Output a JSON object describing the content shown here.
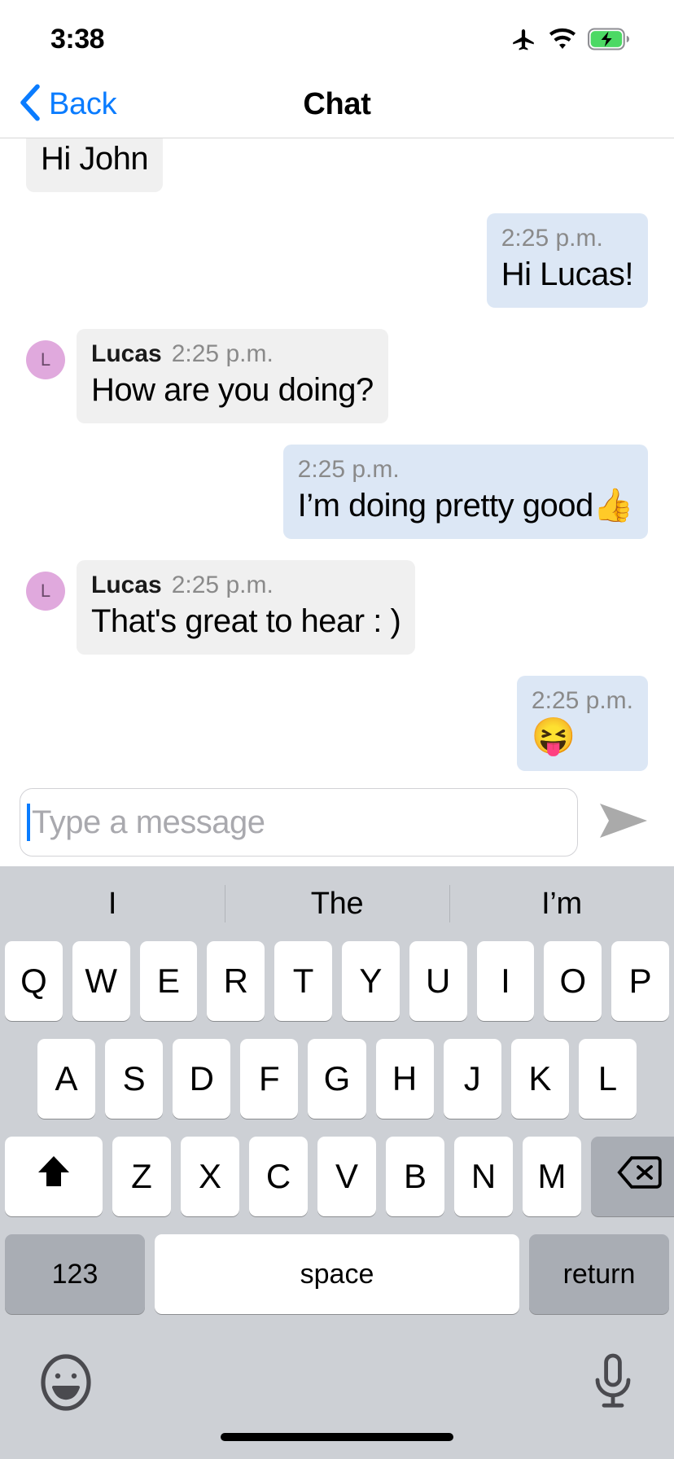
{
  "status_bar": {
    "time": "3:38",
    "icons": [
      "airplane-mode-icon",
      "wifi-icon",
      "battery-charging-icon"
    ]
  },
  "nav_bar": {
    "back_label": "Back",
    "title": "Chat"
  },
  "messages": [
    {
      "id": "msg-1",
      "direction": "in",
      "sender": "",
      "time": "",
      "text": "Hi John",
      "clipped": true,
      "show_avatar": false,
      "show_meta": false
    },
    {
      "id": "msg-2",
      "direction": "out",
      "sender": "",
      "time": "2:25 p.m.",
      "text": "Hi Lucas!",
      "clipped": false,
      "show_avatar": false,
      "show_meta": true
    },
    {
      "id": "msg-3",
      "direction": "in",
      "sender": "Lucas",
      "time": "2:25 p.m.",
      "text": "How are you doing?",
      "clipped": false,
      "show_avatar": true,
      "avatar_initial": "L",
      "show_meta": true
    },
    {
      "id": "msg-4",
      "direction": "out",
      "sender": "",
      "time": "2:25 p.m.",
      "text": "I’m doing pretty good👍",
      "clipped": false,
      "show_avatar": false,
      "show_meta": true
    },
    {
      "id": "msg-5",
      "direction": "in",
      "sender": "Lucas",
      "time": "2:25 p.m.",
      "text": "That's great to hear : )",
      "clipped": false,
      "show_avatar": true,
      "avatar_initial": "L",
      "show_meta": true
    },
    {
      "id": "msg-6",
      "direction": "out",
      "sender": "",
      "time": "2:25 p.m.",
      "text": "😝",
      "clipped": false,
      "show_avatar": false,
      "show_meta": true,
      "emoji_only": true
    }
  ],
  "composer": {
    "placeholder": "Type a message",
    "value": "",
    "send_icon": "send-arrow-icon"
  },
  "keyboard": {
    "predictions": [
      "I",
      "The",
      "I’m"
    ],
    "row1": [
      "Q",
      "W",
      "E",
      "R",
      "T",
      "Y",
      "U",
      "I",
      "O",
      "P"
    ],
    "row2": [
      "A",
      "S",
      "D",
      "F",
      "G",
      "H",
      "J",
      "K",
      "L"
    ],
    "row3": [
      "Z",
      "X",
      "C",
      "V",
      "B",
      "N",
      "M"
    ],
    "shift_label": "shift-up-arrow-icon",
    "backspace_label": "backspace-delete-icon",
    "numeric_label": "123",
    "space_label": "space",
    "return_label": "return",
    "emoji_button": "emoji-smiley-icon",
    "mic_button": "microphone-icon"
  },
  "colors": {
    "accent_blue": "#0a7cff",
    "bubble_in": "#f0f0f0",
    "bubble_out": "#dce7f5",
    "avatar_bg": "#e0a9dd",
    "keyboard_bg": "#cdd0d5",
    "key_white": "#ffffff",
    "key_dark": "#a9adb4",
    "battery_green": "#4cd964"
  }
}
